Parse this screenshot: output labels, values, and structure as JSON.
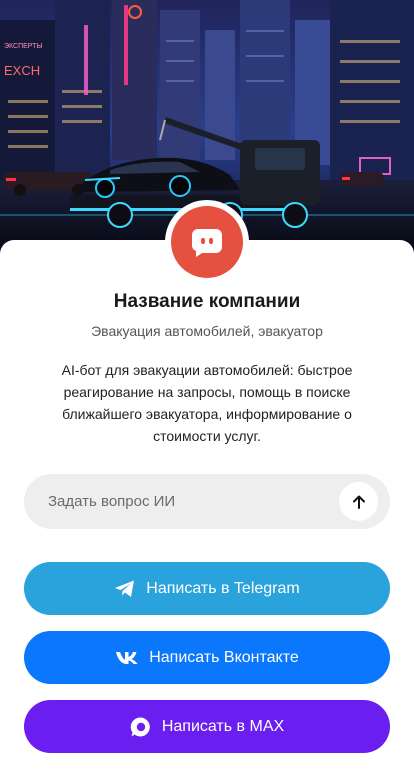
{
  "company": {
    "name": "Название компании",
    "category": "Эвакуация автомобилей, эвакуатор",
    "description": "AI-бот для эвакуации автомобилей: быстрое реагирование на запросы, помощь в поиске ближайшего эвакуатора, информирование о стоимости услуг.",
    "avatar_icon": "chat-bot-icon",
    "avatar_color": "#e5513e"
  },
  "hero": {
    "sign_text": "EXCH",
    "sign_text_2": "ЭКСПЕРТЫ"
  },
  "ask": {
    "placeholder": "Задать вопрос ИИ",
    "send_icon": "arrow-up-icon"
  },
  "buttons": [
    {
      "label": "Написать в Telegram",
      "icon": "telegram-icon",
      "color": "#2aa3dd"
    },
    {
      "label": "Написать Вконтакте",
      "icon": "vk-icon",
      "color": "#0a77fd"
    },
    {
      "label": "Написать в MAX",
      "icon": "max-icon",
      "color": "#6a1ef0"
    }
  ]
}
